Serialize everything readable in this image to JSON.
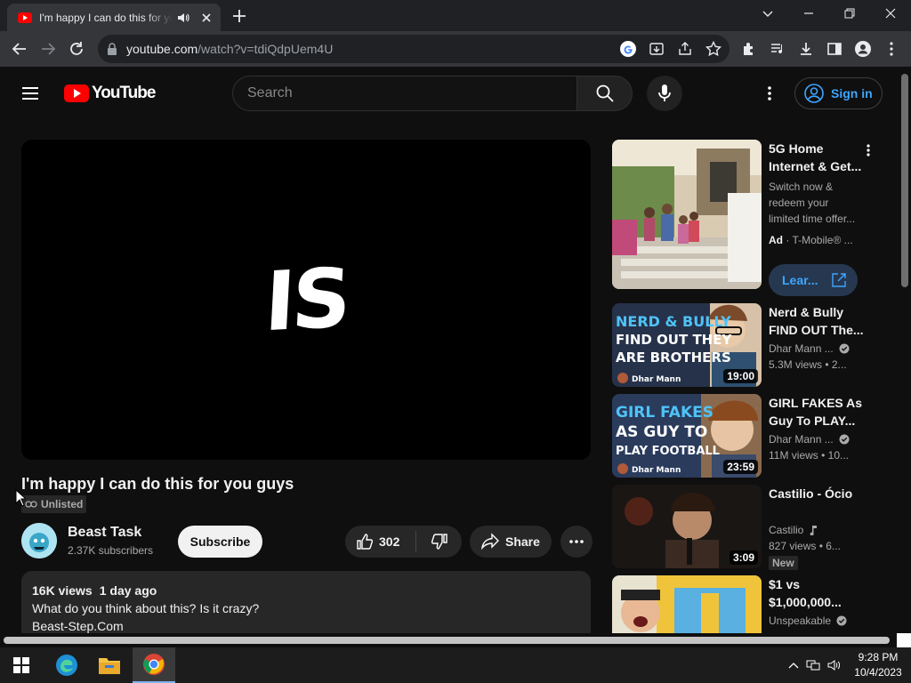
{
  "browser": {
    "tab_title": "I'm happy I can do this for you guys",
    "url_host": "youtube.com",
    "url_path": "/watch?v=tdiQdpUem4U"
  },
  "youtube": {
    "logo_text": "YouTube",
    "search_placeholder": "Search",
    "sign_in": "Sign in"
  },
  "video": {
    "frame_text": "IS",
    "title": "I'm happy I can do this for you guys",
    "visibility": "Unlisted",
    "channel": "Beast Task",
    "subscribers": "2.37K subscribers",
    "subscribe_label": "Subscribe",
    "like_count": "302",
    "share_label": "Share",
    "views": "16K views",
    "age": "1 day ago",
    "description_line1": "What do you think about this? Is it crazy?",
    "description_line2": "Beast-Step.Com"
  },
  "sidebar": {
    "ad": {
      "title": "5G Home Internet & Get...",
      "desc": "Switch now & redeem your limited time offer...",
      "badge": "Ad",
      "brand": "· T-Mobile® ...",
      "button": "Lear..."
    },
    "videos": [
      {
        "title": "Nerd & Bully FIND OUT The...",
        "channel": "Dhar Mann ...",
        "stats": "5.3M views  • 2...",
        "duration": "19:00",
        "thumb_line1": "NERD & BULLY",
        "thumb_line2": "FIND OUT THEY",
        "thumb_line3": "ARE BROTHERS",
        "thumb_tag": "Dhar Mann"
      },
      {
        "title": "GIRL FAKES As Guy To PLAY...",
        "channel": "Dhar Mann ...",
        "stats": "11M views  • 10...",
        "duration": "23:59",
        "thumb_line1": "GIRL FAKES",
        "thumb_line2": "AS GUY TO",
        "thumb_line3": "PLAY FOOTBALL",
        "thumb_tag": "Dhar Mann"
      },
      {
        "title": "Castilio - Ócio",
        "channel": "Castilio",
        "stats": "827 views  • 6...",
        "duration": "3:09",
        "badge": "New"
      },
      {
        "title": "$1 vs $1,000,000...",
        "channel": "Unspeakable"
      }
    ]
  },
  "taskbar": {
    "time": "9:28 PM",
    "date": "10/4/2023"
  },
  "colors": {
    "accent_blue": "#3ea6ff",
    "youtube_red": "#ff0000",
    "background": "#0f0f0f"
  }
}
